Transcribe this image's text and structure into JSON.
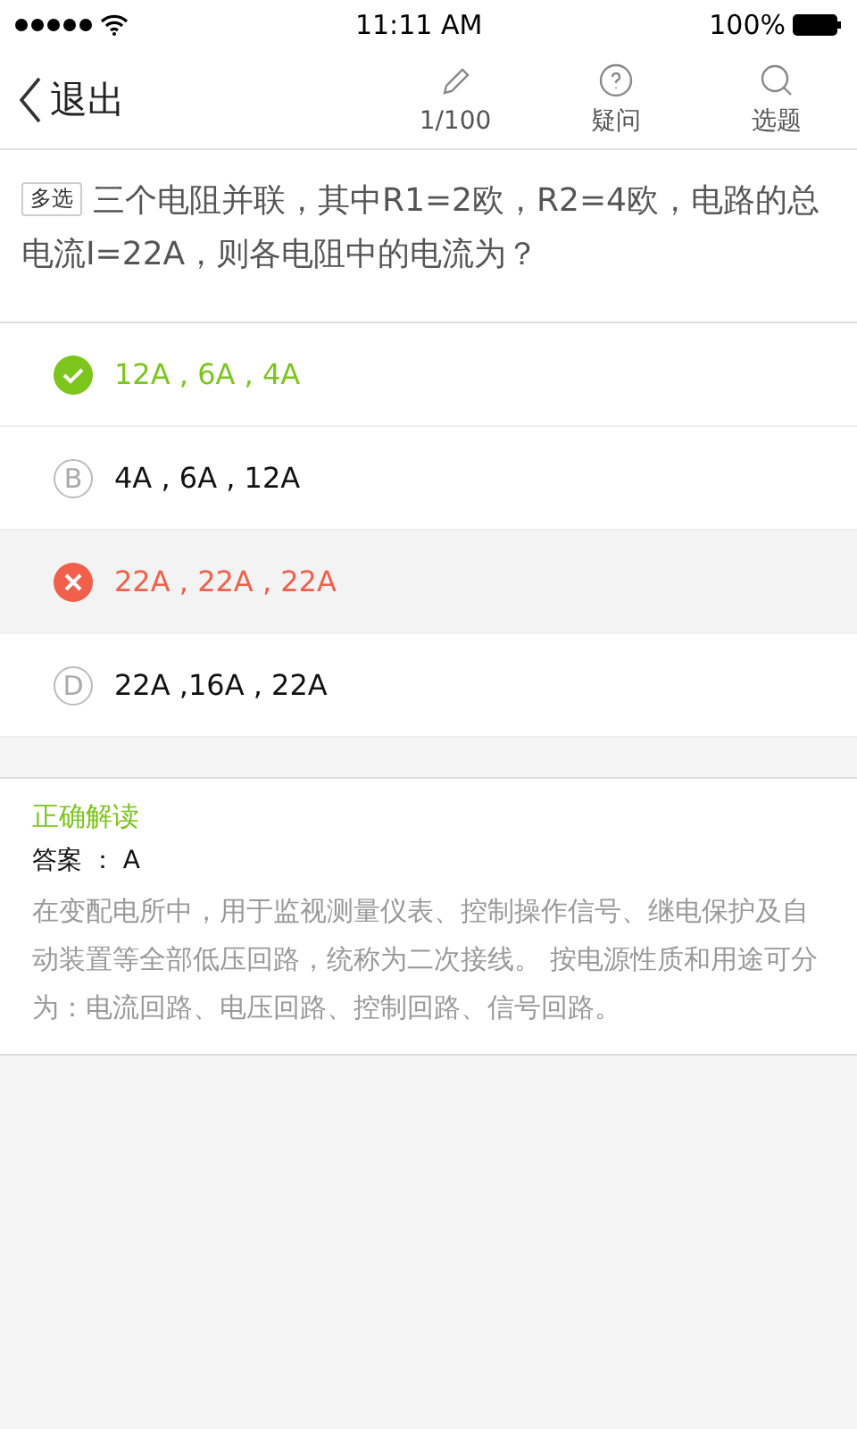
{
  "status_bar": {
    "time": "11:11 AM",
    "battery": "100%"
  },
  "nav": {
    "back": "退出",
    "tools": [
      {
        "kind": "pencil",
        "label": "1/100"
      },
      {
        "kind": "question",
        "label": "疑问"
      },
      {
        "kind": "search",
        "label": "选题"
      }
    ]
  },
  "question": {
    "tag": "多选",
    "text": "三个电阻并联，其中R1=2欧，R2=4欧，电路的总电流I=22A，则各电阻中的电流为？"
  },
  "options": [
    {
      "kind": "correct",
      "text": "12A , 6A , 4A",
      "selected": false
    },
    {
      "kind": "plain",
      "letter": "B",
      "text": "4A , 6A , 12A",
      "selected": false
    },
    {
      "kind": "wrong",
      "text": "22A , 22A , 22A",
      "selected": true
    },
    {
      "kind": "plain",
      "letter": "D",
      "text": "22A ,16A , 22A",
      "selected": false
    }
  ],
  "explanation": {
    "title": "正确解读",
    "answer": "答案 ： A",
    "body": "在变配电所中，用于监视测量仪表、控制操作信号、继电保护及自动装置等全部低压回路，统称为二次接线。 按电源性质和用途可分为：电流回路、电压回路、控制回路、信号回路。"
  }
}
